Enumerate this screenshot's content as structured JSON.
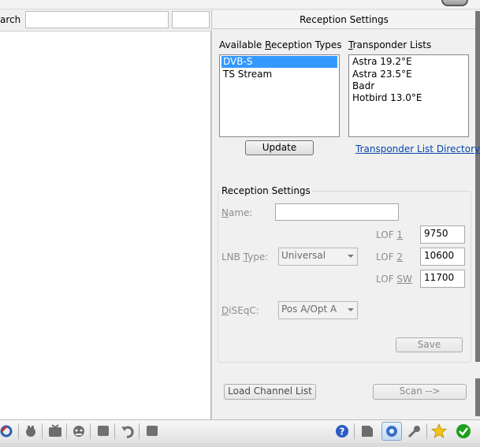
{
  "search": {
    "label": "arch",
    "placeholder": ""
  },
  "panel": {
    "title": "Reception Settings"
  },
  "available_types": {
    "label_pre": "Available ",
    "label_key": "R",
    "label_post": "eception Types",
    "items": [
      "DVB-S",
      "TS Stream"
    ],
    "selected": "DVB-S"
  },
  "transponder": {
    "label_key": "T",
    "label_post": "ransponder Lists",
    "items": [
      "Astra 19.2°E",
      "Astra 23.5°E",
      "Badr",
      "Hotbird 13.0°E"
    ],
    "directory_link": "Transponder List Directory"
  },
  "buttons": {
    "update": "Update",
    "save": "Save",
    "load_channel_list": "Load Channel List",
    "scan": "Scan -->"
  },
  "settings": {
    "group_title": "Reception Settings",
    "name_label_key": "N",
    "name_label_post": "ame:",
    "name_value": "",
    "lnb_label_pre": "LNB ",
    "lnb_label_key": "T",
    "lnb_label_post": "ype:",
    "lnb_value": "Universal",
    "lof1_label_pre": "LOF ",
    "lof1_label_key": "1",
    "lof1_value": "9750",
    "lof2_label_pre": "LOF ",
    "lof2_label_key": "2",
    "lof2_value": "10600",
    "lofsw_label_pre": "LOF ",
    "lofsw_label_key": "SW",
    "lofsw_value": "11700",
    "diseqc_label_key": "D",
    "diseqc_label_post": "iSEqC:",
    "diseqc_value": "Pos A/Opt A"
  },
  "toolbar_icons": [
    "refresh-icon",
    "plug-icon",
    "tv-icon",
    "face-icon",
    "square-icon",
    "undo-icon",
    "box-icon",
    "help-icon",
    "note-icon",
    "settings-icon",
    "key-icon",
    "star-icon",
    "check-icon"
  ],
  "colors": {
    "selection": "#3399ff",
    "link": "#0645ad",
    "help": "#2a5cc8",
    "check": "#1ea01e",
    "star": "#f2c417"
  }
}
